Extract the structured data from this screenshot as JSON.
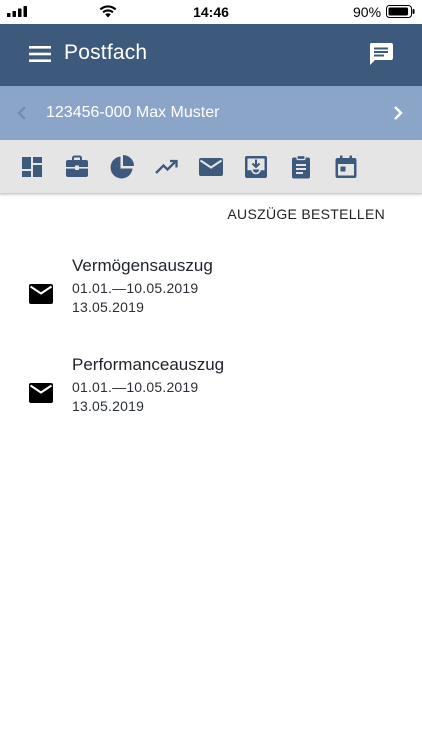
{
  "status_bar": {
    "time": "14:46",
    "battery_percent": "90%",
    "icons": [
      "cellular-signal-icon",
      "wifi-icon",
      "battery-icon"
    ]
  },
  "app_bar": {
    "title": "Postfach",
    "background": "#3d5a7c",
    "icons": {
      "menu": "hamburger-menu-icon",
      "action": "chat-message-icon"
    }
  },
  "account_bar": {
    "label": "123456-000 Max Muster",
    "background": "#8ba5c8",
    "icons": {
      "prev": "chevron-left-icon",
      "next": "chevron-right-icon"
    }
  },
  "icon_tabs": [
    {
      "id": "dashboard",
      "icon": "dashboard-icon",
      "active": false
    },
    {
      "id": "portfolio",
      "icon": "briefcase-icon",
      "active": false
    },
    {
      "id": "allocation",
      "icon": "pie-chart-icon",
      "active": false
    },
    {
      "id": "performance",
      "icon": "trending-up-icon",
      "active": false
    },
    {
      "id": "mailbox",
      "icon": "mail-icon",
      "active": true
    },
    {
      "id": "inbox",
      "icon": "inbox-download-icon",
      "active": false
    },
    {
      "id": "orders",
      "icon": "clipboard-icon",
      "active": false
    },
    {
      "id": "calendar",
      "icon": "calendar-icon",
      "active": false
    }
  ],
  "order_link": "AUSZÜGE BESTELLEN",
  "documents": [
    {
      "title": "Vermögensauszug",
      "range": "01.01.—10.05.2019",
      "date": "13.05.2019",
      "icon": "envelope-icon"
    },
    {
      "title": "Performanceauszug",
      "range": "01.01.—10.05.2019",
      "date": "13.05.2019",
      "icon": "envelope-icon"
    }
  ]
}
